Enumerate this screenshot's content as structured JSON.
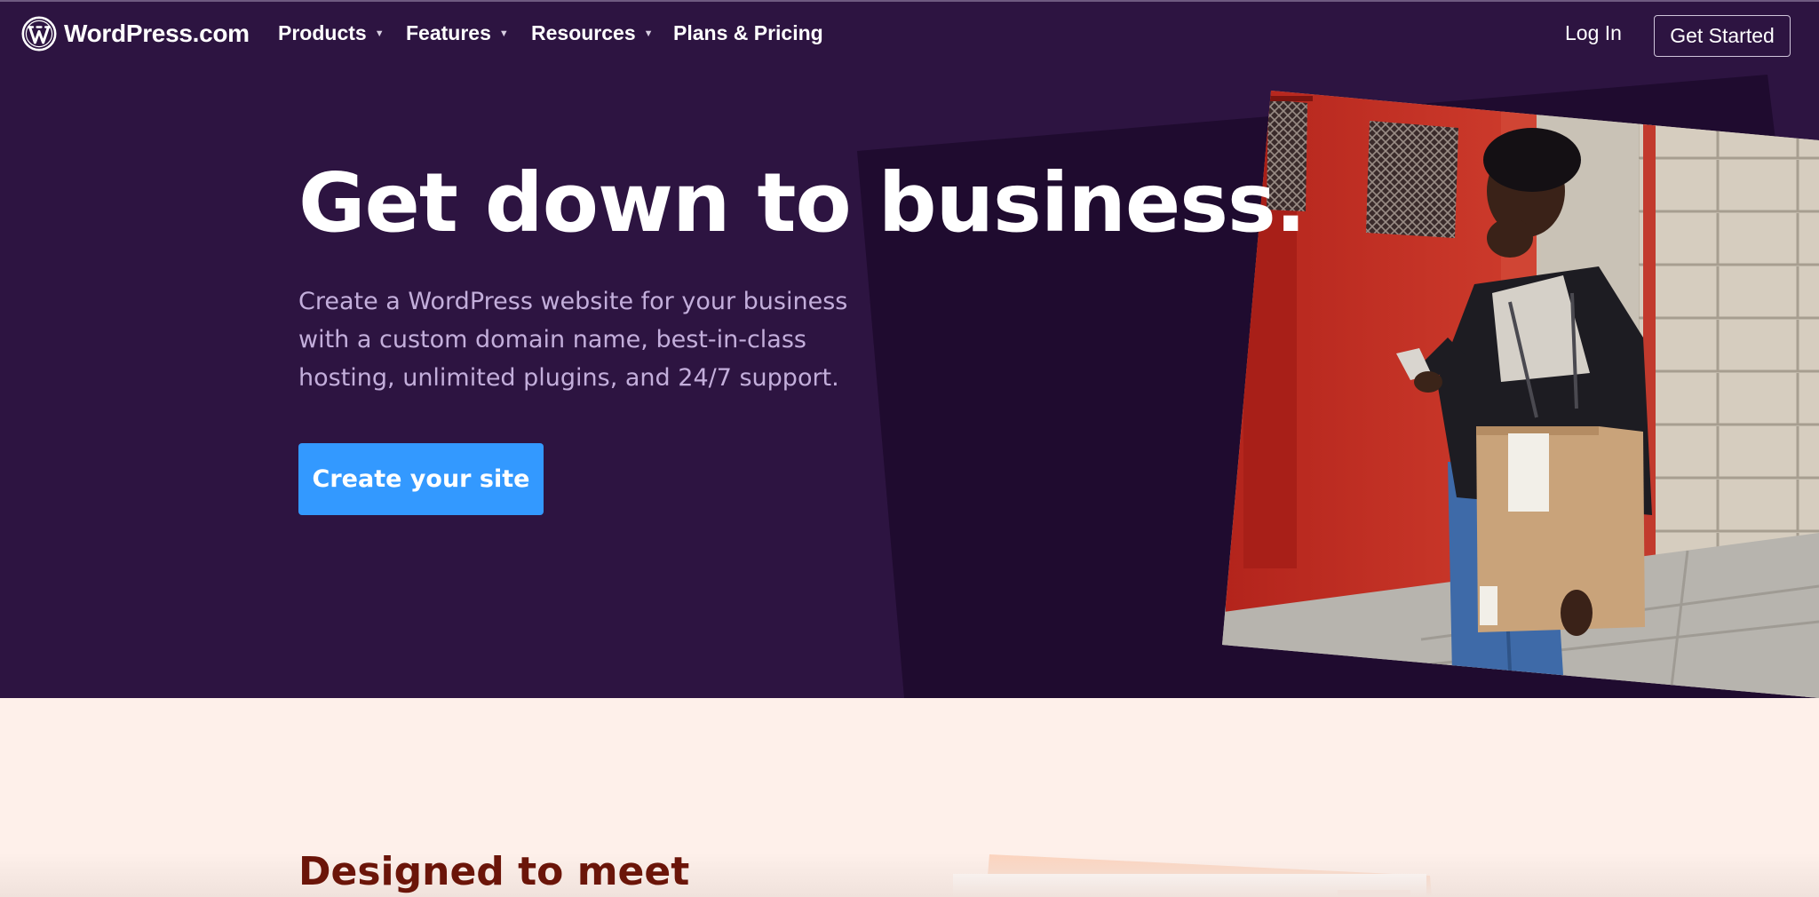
{
  "brand": {
    "name": "WordPress.com",
    "icon": "wordpress-logo-icon"
  },
  "nav": {
    "items": [
      {
        "label": "Products",
        "has_dropdown": true
      },
      {
        "label": "Features",
        "has_dropdown": true
      },
      {
        "label": "Resources",
        "has_dropdown": true
      },
      {
        "label": "Plans & Pricing",
        "has_dropdown": false
      }
    ],
    "caret_glyph": "▼",
    "login_label": "Log In",
    "cta_label": "Get Started"
  },
  "hero": {
    "headline": "Get down to business.",
    "subtext": "Create a WordPress website for your business with a custom domain name, best-in-class hosting, unlimited plugins, and 24/7 support.",
    "cta_label": "Create your site"
  },
  "section2": {
    "title": "Designed to meet"
  },
  "colors": {
    "hero_bg": "#2d1441",
    "accent_blue": "#3399ff",
    "subtext": "#c3aedb",
    "section2_bg": "#fef0ea",
    "section2_title": "#6b1509"
  }
}
